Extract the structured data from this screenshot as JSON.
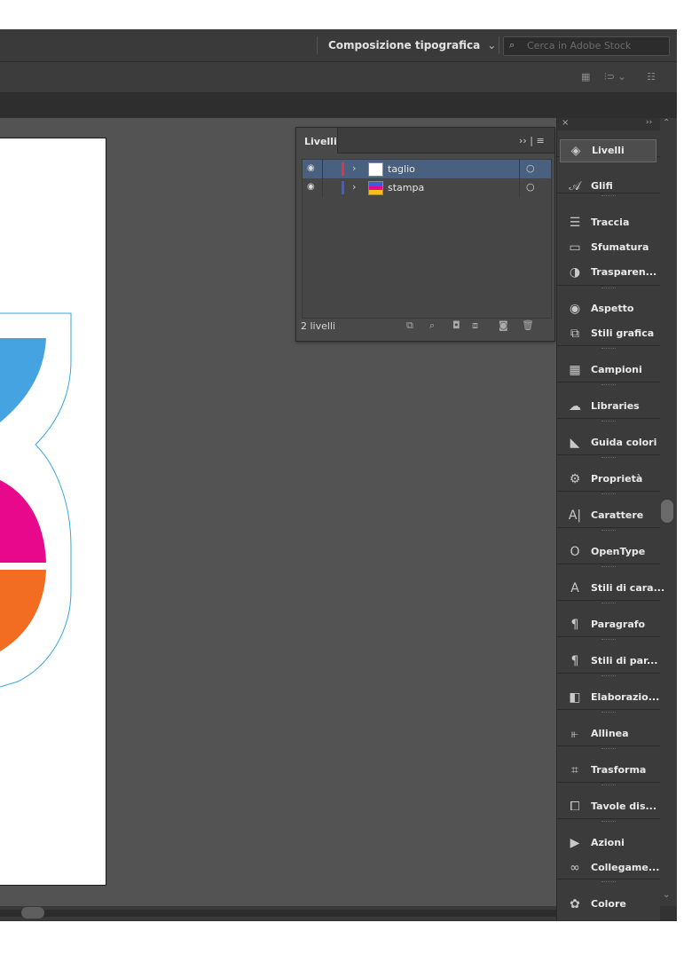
{
  "topbar": {
    "workspace": "Composizione tipografica",
    "workspace_chevron": "⌄",
    "search_icon": "⌕",
    "search_placeholder": "Cerca in Adobe Stock"
  },
  "layers_panel": {
    "tab": "Livelli",
    "header_controls": "›› | ≡",
    "layers": [
      {
        "name": "taglio",
        "color": "#e8323c",
        "selected": true
      },
      {
        "name": "stampa",
        "color": "#3b5fd8",
        "selected": false
      }
    ],
    "count": "2 livelli"
  },
  "dock": {
    "items": [
      {
        "icon": "layers-icon",
        "glyph": "◈",
        "label": "Livelli"
      },
      {
        "icon": "glyphs-icon",
        "glyph": "𝒜",
        "label": "Glifi"
      },
      {
        "icon": "stroke-icon",
        "glyph": "☰",
        "label": "Traccia"
      },
      {
        "icon": "gradient-icon",
        "glyph": "▭",
        "label": "Sfumatura"
      },
      {
        "icon": "transparency-icon",
        "glyph": "◑",
        "label": "Trasparen..."
      },
      {
        "icon": "appearance-icon",
        "glyph": "◉",
        "label": "Aspetto"
      },
      {
        "icon": "graphic-styles-icon",
        "glyph": "⧉",
        "label": "Stili grafica"
      },
      {
        "icon": "swatches-icon",
        "glyph": "▦",
        "label": "Campioni"
      },
      {
        "icon": "libraries-icon",
        "glyph": "☁",
        "label": "Libraries"
      },
      {
        "icon": "color-guide-icon",
        "glyph": "◣",
        "label": "Guida colori"
      },
      {
        "icon": "properties-icon",
        "glyph": "⚙",
        "label": "Proprietà"
      },
      {
        "icon": "character-icon",
        "glyph": "A|",
        "label": "Carattere"
      },
      {
        "icon": "opentype-icon",
        "glyph": "O",
        "label": "OpenType"
      },
      {
        "icon": "character-styles-icon",
        "glyph": "A",
        "label": "Stili di cara..."
      },
      {
        "icon": "paragraph-icon",
        "glyph": "¶",
        "label": "Paragrafo"
      },
      {
        "icon": "paragraph-styles-icon",
        "glyph": "¶",
        "label": "Stili di par..."
      },
      {
        "icon": "pathfinder-icon",
        "glyph": "◧",
        "label": "Elaborazio..."
      },
      {
        "icon": "align-icon",
        "glyph": "⫦",
        "label": "Allinea"
      },
      {
        "icon": "transform-icon",
        "glyph": "⌗",
        "label": "Trasforma"
      },
      {
        "icon": "artboards-icon",
        "glyph": "⧠",
        "label": "Tavole dis..."
      },
      {
        "icon": "actions-icon",
        "glyph": "▶",
        "label": "Azioni"
      },
      {
        "icon": "links-icon",
        "glyph": "∞",
        "label": "Collegame..."
      },
      {
        "icon": "color-icon",
        "glyph": "✿",
        "label": "Colore"
      }
    ]
  },
  "colors": {
    "cut_line": "#38a6dd",
    "blue": "#44a3e0",
    "magenta": "#e8088c",
    "orange": "#f26d21"
  }
}
